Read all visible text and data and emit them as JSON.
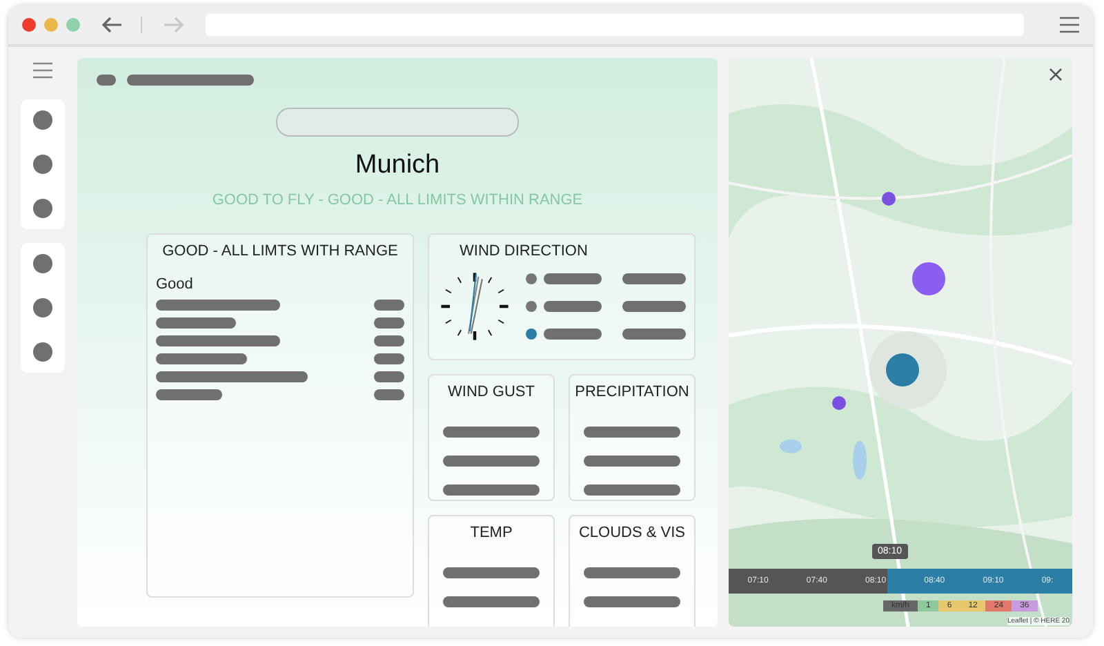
{
  "window": {
    "controls": [
      {
        "color": "#f03a2e"
      },
      {
        "color": "#e8b94a"
      },
      {
        "color": "#8fd1a8"
      }
    ],
    "nav": [
      {
        "kind": "back",
        "disabled": false
      },
      {
        "kind": "forward",
        "disabled": true
      }
    ]
  },
  "sidebar": {
    "groups": [
      {
        "items": [
          {
            "kind": "dot"
          },
          {
            "kind": "dot"
          },
          {
            "kind": "dot"
          }
        ]
      },
      {
        "items": [
          {
            "kind": "dot"
          },
          {
            "kind": "dot"
          },
          {
            "kind": "dot"
          }
        ]
      }
    ]
  },
  "header": {
    "title": "Munich",
    "status": "GOOD TO FLY - GOOD - ALL LIMITS WITHIN RANGE"
  },
  "limits": {
    "title": "GOOD - ALL LIMTS WITH RANGE",
    "label": "Good"
  },
  "wind_direction": {
    "title": "WIND DIRECTION",
    "legend": [
      {
        "color": "#777777"
      },
      {
        "color": "#777777"
      },
      {
        "color": "#2b7ea6"
      }
    ]
  },
  "cards": [
    {
      "title": "WIND GUST"
    },
    {
      "title": "PRECIPITATION"
    },
    {
      "title": "TEMP"
    },
    {
      "title": "CLOUDS & VIS"
    }
  ],
  "map": {
    "timeline": {
      "current": "08:10",
      "level": 0.46,
      "ticks": [
        "07:10",
        "07:40",
        "08:10",
        "08:40",
        "09:10",
        "09:"
      ]
    },
    "legend": [
      {
        "label": "km/h",
        "color": "#666666"
      },
      {
        "label": "1",
        "color": "#8fc89a"
      },
      {
        "label": "6",
        "color": "#e7c86e"
      },
      {
        "label": "12",
        "color": "#e7c86e"
      },
      {
        "label": "24",
        "color": "#e07a6a"
      },
      {
        "label": "36",
        "color": "#c89be0"
      }
    ],
    "attribution": "Leaflet | © HERE 20"
  }
}
